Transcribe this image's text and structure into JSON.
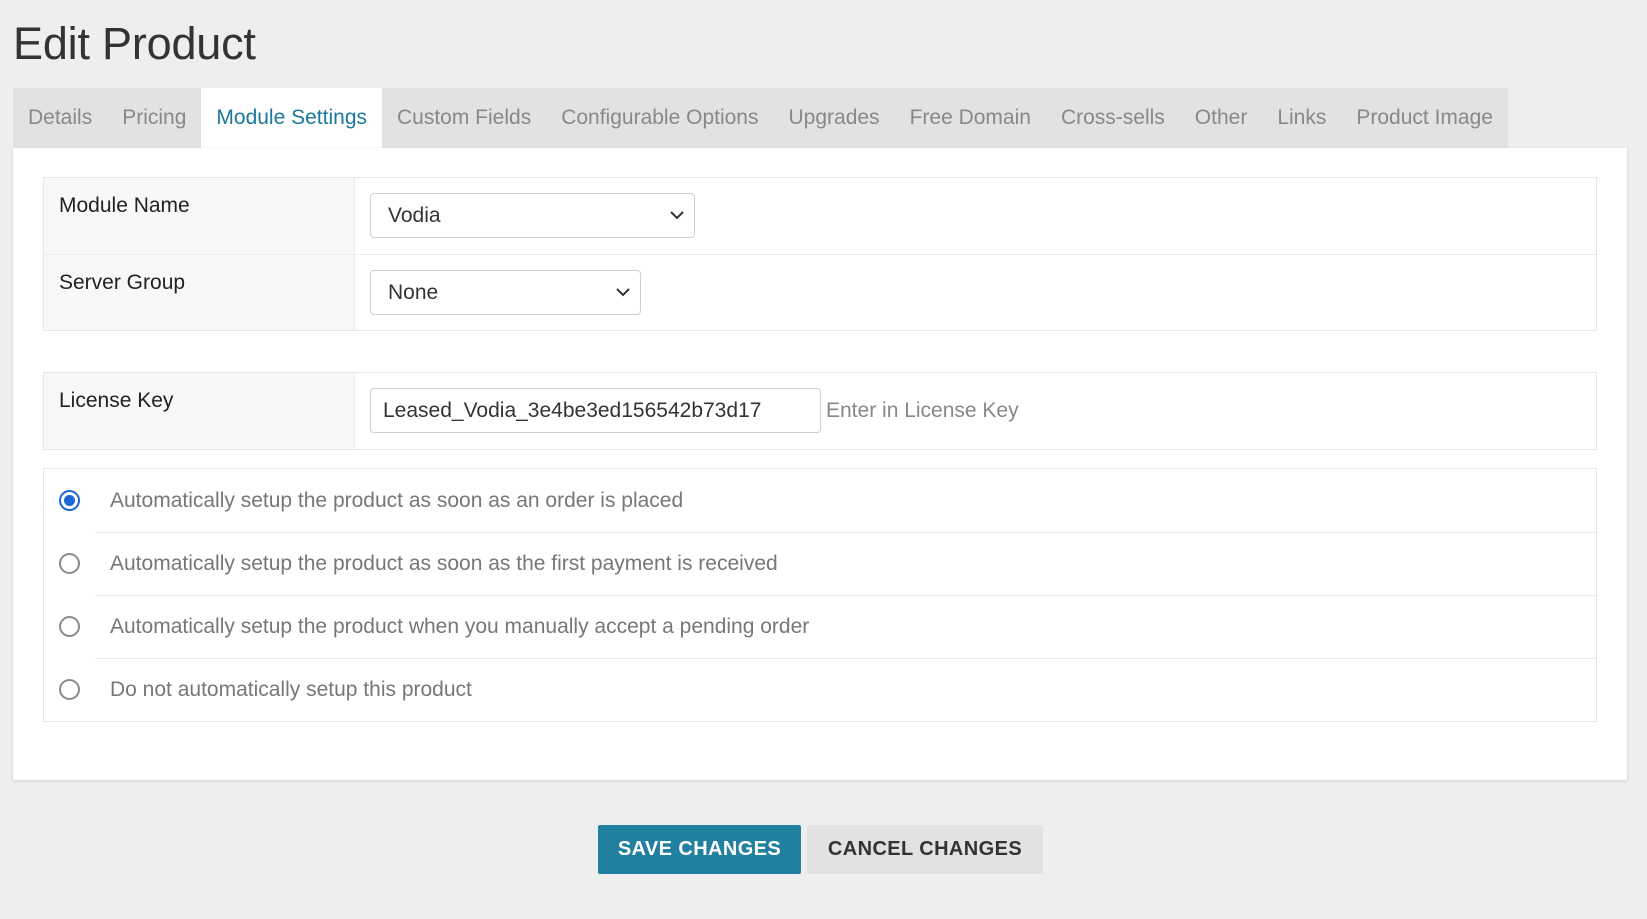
{
  "page": {
    "title": "Edit Product"
  },
  "tabs": [
    {
      "label": "Details",
      "active": false
    },
    {
      "label": "Pricing",
      "active": false
    },
    {
      "label": "Module Settings",
      "active": true
    },
    {
      "label": "Custom Fields",
      "active": false
    },
    {
      "label": "Configurable Options",
      "active": false
    },
    {
      "label": "Upgrades",
      "active": false
    },
    {
      "label": "Free Domain",
      "active": false
    },
    {
      "label": "Cross-sells",
      "active": false
    },
    {
      "label": "Other",
      "active": false
    },
    {
      "label": "Links",
      "active": false
    },
    {
      "label": "Product Image",
      "active": false
    }
  ],
  "module_settings": {
    "module_name": {
      "label": "Module Name",
      "value": "Vodia"
    },
    "server_group": {
      "label": "Server Group",
      "value": "None"
    },
    "license_key": {
      "label": "License Key",
      "value": "Leased_Vodia_3e4be3ed156542b73d17",
      "hint": "Enter in License Key"
    }
  },
  "setup_options": [
    {
      "label": "Automatically setup the product as soon as an order is placed",
      "checked": true
    },
    {
      "label": "Automatically setup the product as soon as the first payment is received",
      "checked": false
    },
    {
      "label": "Automatically setup the product when you manually accept a pending order",
      "checked": false
    },
    {
      "label": "Do not automatically setup this product",
      "checked": false
    }
  ],
  "actions": {
    "save_label": "SAVE CHANGES",
    "cancel_label": "CANCEL CHANGES"
  },
  "colors": {
    "accent": "#217f9f",
    "active_tab_text": "#1b7a9c",
    "radio_checked": "#1a66d6",
    "background": "#eeeeee"
  },
  "icons": {
    "select_caret": "chevron-down-icon"
  }
}
